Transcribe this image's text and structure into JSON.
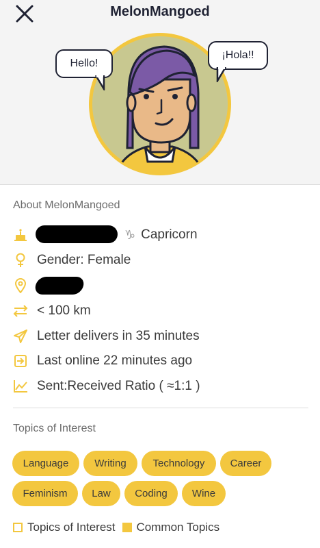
{
  "header": {
    "title": "MelonMangoed",
    "close_icon": "close-icon"
  },
  "avatar": {
    "bubble_left": "Hello!",
    "bubble_right": "¡Hola!!"
  },
  "about": {
    "heading": "About MelonMangoed",
    "zodiac": "Capricorn",
    "gender": "Gender: Female",
    "distance": "< 100 km",
    "delivery": "Letter delivers in 35 minutes",
    "last_online": "Last online 22 minutes ago",
    "ratio": "Sent:Received Ratio ( ≈1:1 )"
  },
  "topics": {
    "heading": "Topics of Interest",
    "tags": [
      "Language",
      "Writing",
      "Technology",
      "Career",
      "Feminism",
      "Law",
      "Coding",
      "Wine"
    ]
  },
  "legend": {
    "interest_label": "Topics of Interest",
    "common_label": "Common Topics"
  },
  "colors": {
    "accent": "#f3c73f",
    "title": "#1f2233",
    "avatar_bg": "#c8c890",
    "hair": "#7b5aa6",
    "skin": "#e9b988"
  }
}
